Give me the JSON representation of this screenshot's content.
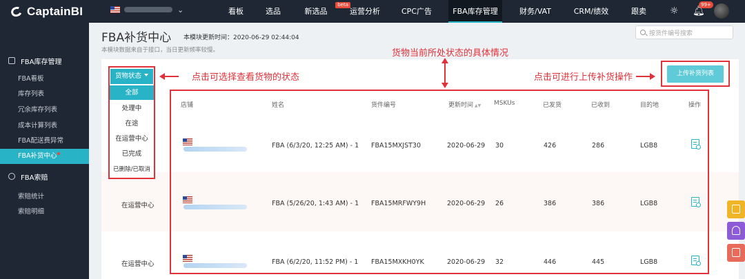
{
  "app": {
    "logo_text": "CaptainBI"
  },
  "topnav": {
    "items": [
      {
        "label": "看板"
      },
      {
        "label": "选品"
      },
      {
        "label": "新选品",
        "badge": "beta"
      },
      {
        "label": "运营分析"
      },
      {
        "label": "CPC广告"
      },
      {
        "label": "FBA库存管理",
        "active": true
      },
      {
        "label": "财务/VAT"
      },
      {
        "label": "CRM/绩效"
      },
      {
        "label": "跟卖"
      }
    ],
    "notification_count": "99+",
    "icons": [
      "settings-icon",
      "bell-icon",
      "avatar"
    ]
  },
  "sidebar": {
    "group1": {
      "label": "FBA库存管理",
      "icon": "warehouse-icon"
    },
    "group1_items": [
      "FBA看板",
      "库存列表",
      "冗余库存列表",
      "成本计算列表",
      "FBA配送费异常",
      "FBA补货中心"
    ],
    "active_item": "FBA补货中心",
    "group2": {
      "label": "FBA索赔",
      "icon": "claim-icon"
    },
    "group2_items": [
      "索赔统计",
      "索赔明细"
    ]
  },
  "page": {
    "title": "FBA补货中心",
    "update_time": "本模块更新时间：2020-06-29 02:44:04",
    "sub_note": "本模块数据来自于接口，当日更新频率较慢。",
    "search_placeholder": "按货件编号搜索",
    "upload_button": "上传补货列表"
  },
  "status_filter": {
    "label": "货物状态",
    "options": [
      "全部",
      "处理中",
      "在途",
      "在运营中心",
      "已完成",
      "已删除/已取消"
    ],
    "selected": "全部"
  },
  "annotations": {
    "status_hint": "点击可选择查看货物的状态",
    "table_hint": "货物当前所处状态的具体情况",
    "upload_hint": "点击可进行上传补货操作"
  },
  "table": {
    "columns": [
      "店铺",
      "姓名",
      "货件编号",
      "更新时间",
      "MSKUs",
      "已发货",
      "已收到",
      "目的地",
      "操作"
    ],
    "rows": [
      {
        "status": "",
        "name": "FBA (6/3/20, 12:25 AM) - 1",
        "shipment_id": "FBA15MXJST30",
        "updated": "2020-06-29",
        "mskus": "30",
        "shipped": "426",
        "received": "286",
        "destination": "LGB8"
      },
      {
        "status": "在运营中心",
        "name": "FBA (5/26/20, 1:43 AM) - 1",
        "shipment_id": "FBA15MRFWY9H",
        "updated": "2020-06-29",
        "mskus": "26",
        "shipped": "386",
        "received": "386",
        "destination": "LGB8"
      },
      {
        "status": "在运营中心",
        "name": "FBA (6/2/20, 11:52 PM) - 1",
        "shipment_id": "FBA15MXKH0YK",
        "updated": "2020-06-29",
        "mskus": "32",
        "shipped": "446",
        "received": "445",
        "destination": "LGB8"
      }
    ]
  },
  "colors": {
    "accent": "#29b3c6",
    "annotation": "#e0323a",
    "nav_bg": "#1e2733"
  }
}
